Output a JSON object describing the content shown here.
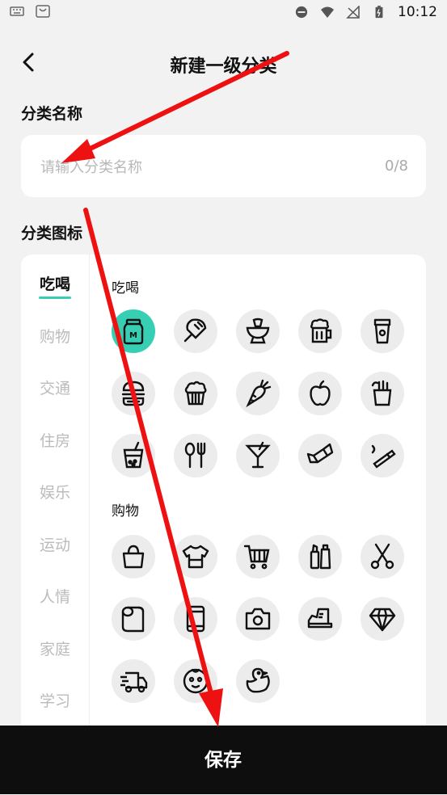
{
  "status_bar": {
    "time": "10:12"
  },
  "header": {
    "title": "新建一级分类"
  },
  "name_section": {
    "label": "分类名称",
    "input_placeholder": "请输入分类名称",
    "input_value": "",
    "counter": "0/8"
  },
  "icon_section": {
    "label": "分类图标"
  },
  "categories": [
    "吃喝",
    "购物",
    "交通",
    "住房",
    "娱乐",
    "运动",
    "人情",
    "家庭",
    "学习"
  ],
  "active_category": "吃喝",
  "groups": [
    {
      "label": "吃喝",
      "icons": [
        "milk-jar-icon",
        "popsicle-icon",
        "mortar-icon",
        "beer-mug-icon",
        "coffee-cup-icon",
        "burger-icon",
        "cupcake-icon",
        "carrot-icon",
        "apple-icon",
        "fries-icon",
        "bubble-tea-icon",
        "utensils-icon",
        "cocktail-icon",
        "candy-icon",
        "cigarette-icon"
      ]
    },
    {
      "label": "购物",
      "icons": [
        "handbag-icon",
        "tshirt-icon",
        "shopping-cart-icon",
        "cosmetics-icon",
        "scissors-icon",
        "toilet-paper-icon",
        "phone-icon",
        "camera-icon",
        "sneaker-icon",
        "diamond-icon",
        "delivery-truck-icon",
        "baby-face-icon",
        "rubber-duck-icon"
      ]
    }
  ],
  "selected_icon": "milk-jar-icon",
  "bottom": {
    "save_label": "保存"
  },
  "colors": {
    "accent": "#36cfb4",
    "annotation_arrow": "#ee1111",
    "bottom_bar": "#0e0e0e"
  }
}
